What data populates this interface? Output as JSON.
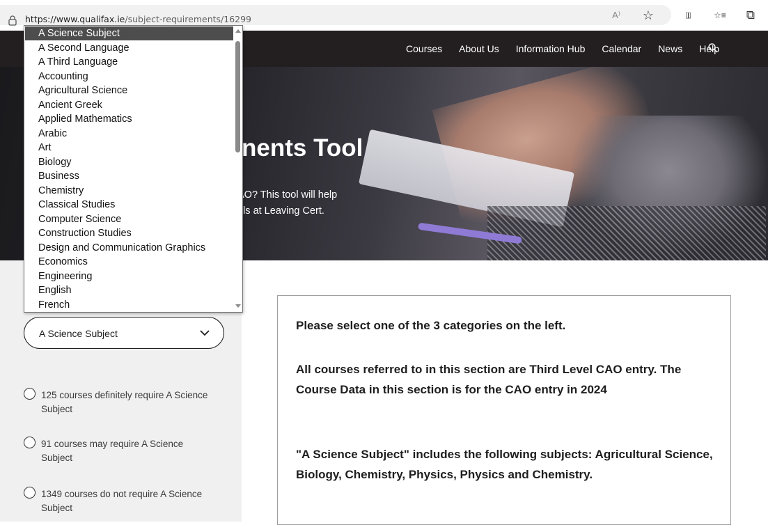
{
  "browser": {
    "url_host": "https://www.qualifax.ie",
    "url_path": "/subject-requirements/16299",
    "icons": [
      "lock-icon",
      "read-aloud-icon",
      "favorite-star-icon",
      "split-screen-icon",
      "favorites-list-icon",
      "collections-icon"
    ],
    "read_aloud_glyph": "A⁾",
    "star_glyph": "☆",
    "split_glyph": "▯▯",
    "favlist_glyph": "☆≡",
    "collections_glyph": "⧉"
  },
  "nav": {
    "items": [
      "Courses",
      "About Us",
      "Information Hub",
      "Calendar",
      "News",
      "Help"
    ]
  },
  "hero": {
    "title_fragment": "nents Tool",
    "subtitle_fragment": "AO? This tool will help\nels at Leaving Cert."
  },
  "dropdown": {
    "selected": "A Science Subject",
    "options": [
      "A Science Subject",
      "A Second Language",
      "A Third Language",
      "Accounting",
      "Agricultural Science",
      "Ancient Greek",
      "Applied Mathematics",
      "Arabic",
      "Art",
      "Biology",
      "Business",
      "Chemistry",
      "Classical Studies",
      "Computer Science",
      "Construction Studies",
      "Design and Communication Graphics",
      "Economics",
      "Engineering",
      "English",
      "French"
    ]
  },
  "filters": {
    "select_value": "A Science Subject",
    "radios": [
      "125 courses definitely require A Science Subject",
      "91 courses may require A Science Subject",
      "1349 courses do not require A Science Subject"
    ]
  },
  "info": {
    "p1": "Please select one of the 3 categories on the left.",
    "p2": "All courses referred to in this section are Third Level CAO entry. The Course Data in this section is for the CAO entry in 2024",
    "p3": "\"A Science Subject\" includes the following subjects: Agricultural Science, Biology, Chemistry, Physics, Physics and Chemistry."
  },
  "colors": {
    "nav_bg": "#231f20",
    "panel_bg": "#f0f0f0",
    "selected_option_bg": "#4d4d4d"
  }
}
